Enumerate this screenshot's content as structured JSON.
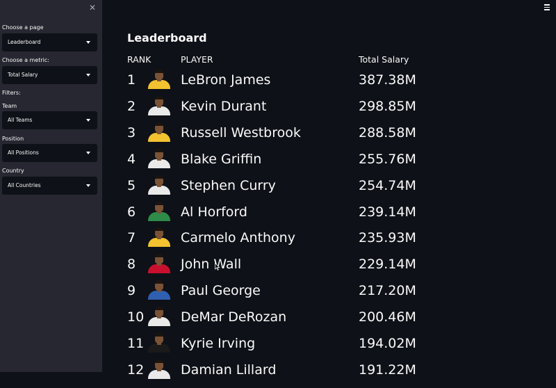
{
  "sidebar": {
    "close_glyph": "✕",
    "page_label": "Choose a page",
    "page_value": "Leaderboard",
    "metric_label": "Choose a metric:",
    "metric_value": "Total Salary",
    "filters_label": "Filters:",
    "team_label": "Team",
    "team_value": "All Teams",
    "position_label": "Position",
    "position_value": "All Positions",
    "country_label": "Country",
    "country_value": "All Countries"
  },
  "main": {
    "title": "Leaderboard",
    "headers": {
      "rank": "RANK",
      "player": "PLAYER",
      "metric": "Total Salary"
    },
    "rows": [
      {
        "rank": "1",
        "player": "LeBron James",
        "value": "387.38M",
        "jersey": "#f2c230"
      },
      {
        "rank": "2",
        "player": "Kevin Durant",
        "value": "298.85M",
        "jersey": "#e9e9e9"
      },
      {
        "rank": "3",
        "player": "Russell Westbrook",
        "value": "288.58M",
        "jersey": "#f2c230"
      },
      {
        "rank": "4",
        "player": "Blake Griffin",
        "value": "255.76M",
        "jersey": "#e9e9e9"
      },
      {
        "rank": "5",
        "player": "Stephen Curry",
        "value": "254.74M",
        "jersey": "#e9e9e9"
      },
      {
        "rank": "6",
        "player": "Al Horford",
        "value": "239.14M",
        "jersey": "#2e8b4a"
      },
      {
        "rank": "7",
        "player": "Carmelo Anthony",
        "value": "235.93M",
        "jersey": "#f2c230"
      },
      {
        "rank": "8",
        "player": "John Wall",
        "value": "229.14M",
        "jersey": "#c8102e"
      },
      {
        "rank": "9",
        "player": "Paul George",
        "value": "217.20M",
        "jersey": "#2f5fb0"
      },
      {
        "rank": "10",
        "player": "DeMar DeRozan",
        "value": "200.46M",
        "jersey": "#e9e9e9"
      },
      {
        "rank": "11",
        "player": "Kyrie Irving",
        "value": "194.02M",
        "jersey": "#1a1a1a"
      },
      {
        "rank": "12",
        "player": "Damian Lillard",
        "value": "191.22M",
        "jersey": "#e9e9e9"
      }
    ]
  },
  "colors": {
    "background": "#0e1117",
    "sidebar": "#262730",
    "text": "#fafafa"
  }
}
